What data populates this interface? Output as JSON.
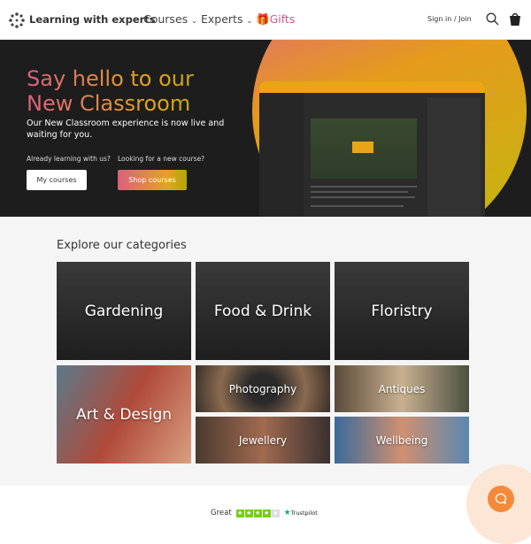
{
  "header": {
    "brand": "Learning with experts",
    "nav": [
      {
        "label": "Courses"
      },
      {
        "label": "Experts"
      },
      {
        "label": "Gifts"
      }
    ],
    "sign_in": "Sign in",
    "separator": "/",
    "join": "Join"
  },
  "hero": {
    "title_line1": "Say hello to our",
    "title_line2": "New Classroom",
    "subtitle": "Our New Classroom experience is now live and waiting for you.",
    "existing_prompt": "Already learning with us?",
    "existing_button": "My courses",
    "new_prompt": "Looking for a new course?",
    "new_button": "Shop courses"
  },
  "categories": {
    "title": "Explore our categories",
    "items": [
      {
        "label": "Gardening"
      },
      {
        "label": "Food & Drink"
      },
      {
        "label": "Floristry"
      },
      {
        "label": "Art & Design"
      },
      {
        "label": "Photography"
      },
      {
        "label": "Antiques"
      },
      {
        "label": "Jewellery"
      },
      {
        "label": "Wellbeing"
      }
    ]
  },
  "trustpilot": {
    "rating_text": "Great",
    "stars": 4,
    "brand": "Trustpilot"
  },
  "colors": {
    "accent": "#e4a222",
    "pink": "#d9607e",
    "gifts": "#d0568a",
    "chat": "#f58a3a",
    "trustpilot": "#73cf11"
  }
}
